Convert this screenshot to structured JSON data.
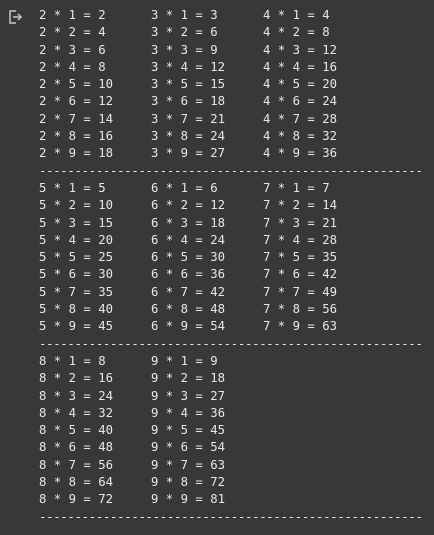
{
  "output": {
    "icon": "output-redirect-icon",
    "blocks": [
      {
        "rows": [
          [
            "2 * 1 = 2",
            "3 * 1 = 3",
            "4 * 1 = 4"
          ],
          [
            "2 * 2 = 4",
            "3 * 2 = 6",
            "4 * 2 = 8"
          ],
          [
            "2 * 3 = 6",
            "3 * 3 = 9",
            "4 * 3 = 12"
          ],
          [
            "2 * 4 = 8",
            "3 * 4 = 12",
            "4 * 4 = 16"
          ],
          [
            "2 * 5 = 10",
            "3 * 5 = 15",
            "4 * 5 = 20"
          ],
          [
            "2 * 6 = 12",
            "3 * 6 = 18",
            "4 * 6 = 24"
          ],
          [
            "2 * 7 = 14",
            "3 * 7 = 21",
            "4 * 7 = 28"
          ],
          [
            "2 * 8 = 16",
            "3 * 8 = 24",
            "4 * 8 = 32"
          ],
          [
            "2 * 9 = 18",
            "3 * 9 = 27",
            "4 * 9 = 36"
          ]
        ],
        "separator": "------------------------------------------------------"
      },
      {
        "rows": [
          [
            "5 * 1 = 5",
            "6 * 1 = 6",
            "7 * 1 = 7"
          ],
          [
            "5 * 2 = 10",
            "6 * 2 = 12",
            "7 * 2 = 14"
          ],
          [
            "5 * 3 = 15",
            "6 * 3 = 18",
            "7 * 3 = 21"
          ],
          [
            "5 * 4 = 20",
            "6 * 4 = 24",
            "7 * 4 = 28"
          ],
          [
            "5 * 5 = 25",
            "6 * 5 = 30",
            "7 * 5 = 35"
          ],
          [
            "5 * 6 = 30",
            "6 * 6 = 36",
            "7 * 6 = 42"
          ],
          [
            "5 * 7 = 35",
            "6 * 7 = 42",
            "7 * 7 = 49"
          ],
          [
            "5 * 8 = 40",
            "6 * 8 = 48",
            "7 * 8 = 56"
          ],
          [
            "5 * 9 = 45",
            "6 * 9 = 54",
            "7 * 9 = 63"
          ]
        ],
        "separator": "------------------------------------------------------"
      },
      {
        "rows": [
          [
            "8 * 1 = 8",
            "9 * 1 = 9",
            ""
          ],
          [
            "8 * 2 = 16",
            "9 * 2 = 18",
            ""
          ],
          [
            "8 * 3 = 24",
            "9 * 3 = 27",
            ""
          ],
          [
            "8 * 4 = 32",
            "9 * 4 = 36",
            ""
          ],
          [
            "8 * 5 = 40",
            "9 * 5 = 45",
            ""
          ],
          [
            "8 * 6 = 48",
            "9 * 6 = 54",
            ""
          ],
          [
            "8 * 7 = 56",
            "9 * 7 = 63",
            ""
          ],
          [
            "8 * 8 = 64",
            "9 * 8 = 72",
            ""
          ],
          [
            "8 * 9 = 72",
            "9 * 9 = 81",
            ""
          ]
        ],
        "separator": "------------------------------------------------------"
      }
    ]
  }
}
